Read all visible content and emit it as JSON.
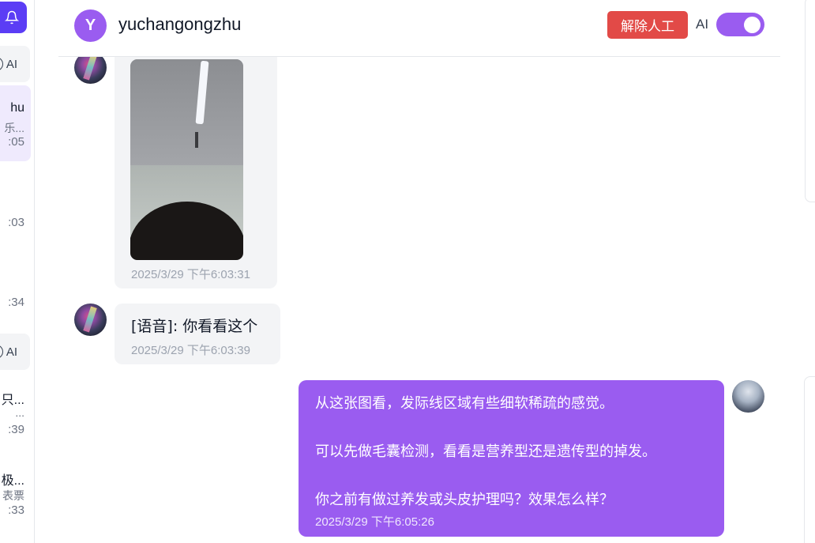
{
  "sidebar": {
    "badge_label": "AI",
    "items": [
      {
        "name": "hu",
        "snippet": "乐...",
        "time": ":05",
        "active": true
      },
      {
        "name": "",
        "snippet": "",
        "time": ":03",
        "active": false
      },
      {
        "name": "",
        "snippet": "",
        "time": ":34",
        "active": false
      },
      {
        "name": "只...",
        "snippet": "...",
        "time": ":39",
        "active": false
      },
      {
        "name": "极...",
        "snippet": "表票",
        "time": ":33",
        "active": false
      }
    ]
  },
  "header": {
    "avatar_letter": "Y",
    "user_name": "yuchangongzhu",
    "release_button": "解除人工",
    "ai_label": "AI",
    "ai_toggle_on": true
  },
  "messages": [
    {
      "direction": "in",
      "type": "image",
      "time": "2025/3/29 下午6:03:31"
    },
    {
      "direction": "in",
      "type": "text",
      "text": "[语音]: 你看看这个",
      "time": "2025/3/29 下午6:03:39"
    },
    {
      "direction": "out",
      "type": "text",
      "lines": [
        "从这张图看，发际线区域有些细软稀疏的感觉。",
        "可以先做毛囊检测，看看是营养型还是遗传型的掉发。",
        "你之前有做过养发或头皮护理吗？效果怎么样？"
      ],
      "time": "2025/3/29 下午6:05:26"
    }
  ],
  "colors": {
    "accent": "#9a5cf0",
    "danger": "#e24a47",
    "bell_button": "#5b3df5",
    "active_item_bg": "#efeafd"
  },
  "icons": {
    "bell": "bell-icon",
    "ai_indicator": "ai-ring-icon"
  }
}
